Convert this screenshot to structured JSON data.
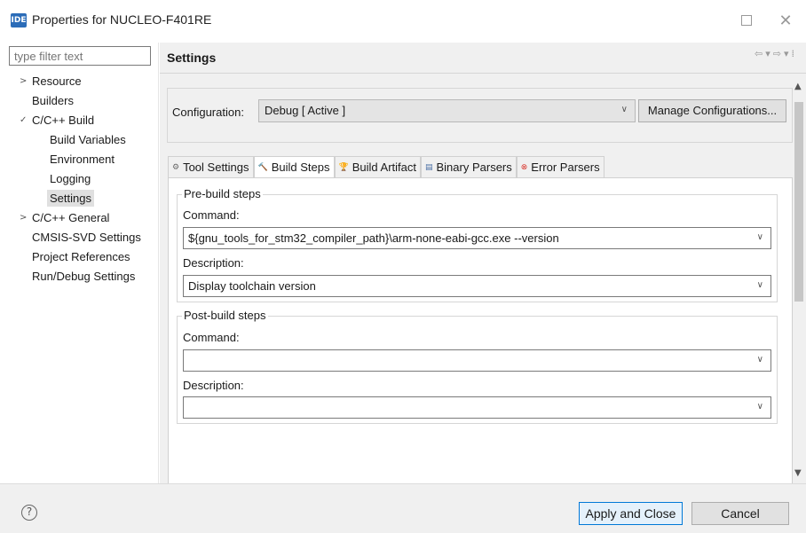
{
  "window": {
    "app_icon_text": "IDE",
    "title": "Properties for NUCLEO-F401RE"
  },
  "sidebar": {
    "filter_placeholder": "type filter text",
    "items": [
      {
        "label": "Resource",
        "level": 0,
        "arrow": "collapsed"
      },
      {
        "label": "Builders",
        "level": 0,
        "arrow": "none"
      },
      {
        "label": "C/C++ Build",
        "level": 0,
        "arrow": "expanded"
      },
      {
        "label": "Build Variables",
        "level": 1,
        "arrow": "none"
      },
      {
        "label": "Environment",
        "level": 1,
        "arrow": "none"
      },
      {
        "label": "Logging",
        "level": 1,
        "arrow": "none"
      },
      {
        "label": "Settings",
        "level": 1,
        "arrow": "none",
        "selected": true
      },
      {
        "label": "C/C++ General",
        "level": 0,
        "arrow": "collapsed"
      },
      {
        "label": "CMSIS-SVD Settings",
        "level": 0,
        "arrow": "none"
      },
      {
        "label": "Project References",
        "level": 0,
        "arrow": "none"
      },
      {
        "label": "Run/Debug Settings",
        "level": 0,
        "arrow": "none"
      }
    ]
  },
  "main": {
    "title": "Settings",
    "configuration_label": "Configuration:",
    "configuration_value": "Debug  [ Active ]",
    "manage_button": "Manage Configurations...",
    "tabs": [
      {
        "label": "Tool Settings",
        "icon": "tool-settings-icon",
        "active": false
      },
      {
        "label": "Build Steps",
        "icon": "build-steps-icon",
        "active": true
      },
      {
        "label": "Build Artifact",
        "icon": "build-artifact-icon",
        "active": false
      },
      {
        "label": "Binary Parsers",
        "icon": "binary-parsers-icon",
        "active": false
      },
      {
        "label": "Error Parsers",
        "icon": "error-parsers-icon",
        "active": false
      }
    ],
    "pre_build": {
      "title": "Pre-build steps",
      "command_label": "Command:",
      "command_value": "${gnu_tools_for_stm32_compiler_path}\\arm-none-eabi-gcc.exe --version",
      "description_label": "Description:",
      "description_value": "Display toolchain version"
    },
    "post_build": {
      "title": "Post-build steps",
      "command_label": "Command:",
      "command_value": "",
      "description_label": "Description:",
      "description_value": ""
    }
  },
  "footer": {
    "help_symbol": "?",
    "apply_button": "Apply and Close",
    "cancel_button": "Cancel"
  },
  "colors": {
    "accent": "#0078d7",
    "panel_bg": "#f0f0f0",
    "selected_bg": "#e0e0e0"
  }
}
